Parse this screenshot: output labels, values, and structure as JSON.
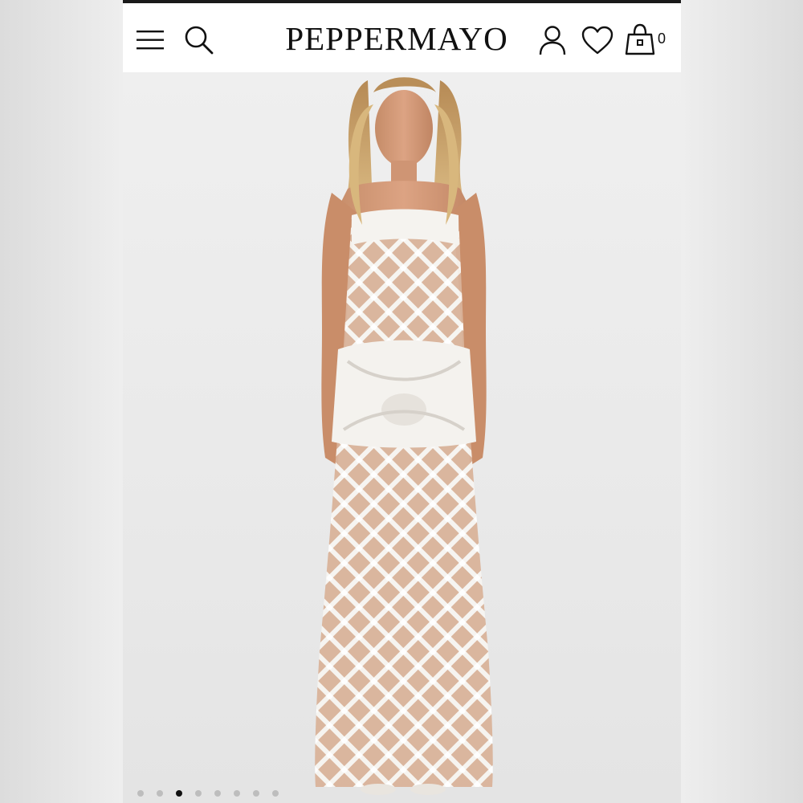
{
  "header": {
    "brand": "PEPPERMAYO",
    "bag_count": "0",
    "icons": {
      "menu": "hamburger-menu-icon",
      "search": "search-icon",
      "account": "account-icon",
      "wishlist": "heart-icon",
      "bag": "shopping-bag-icon"
    }
  },
  "colors": {
    "topbar": "#1a1a1a",
    "header_bg": "#ffffff",
    "icon": "#111111",
    "dot_inactive": "#bdbdbd",
    "dot_active": "#111111"
  },
  "carousel": {
    "total_slides": 8,
    "active_index": 3
  }
}
